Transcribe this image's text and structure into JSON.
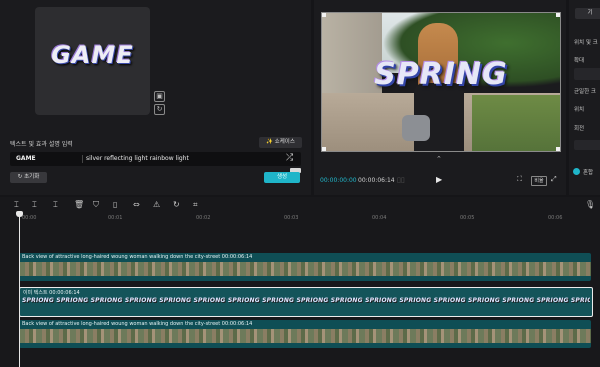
{
  "generator": {
    "preview_text": "GAME",
    "prompt_label": "텍스트 및 효과 설명 입력",
    "showcase_button": "✨ 쇼케이스",
    "text_value": "GAME",
    "effect_value": "silver reflecting light rainbow light",
    "reset_button": "↻ 초기화",
    "generate_button": "생성",
    "shuffle_icon": "shuffle-icon"
  },
  "preview": {
    "overlay_text": "SPRING",
    "time_current": "00:00:00:00",
    "time_total": "00:00:06:14",
    "ratio_label": "비율"
  },
  "right_panel": {
    "tab": "기",
    "labels": [
      "위치 및 크",
      "확대",
      "균일한 크",
      "위치",
      "회전"
    ],
    "checkbox_label": "혼합"
  },
  "timeline": {
    "ruler": [
      "00:00",
      "00:01",
      "00:02",
      "00:03",
      "00:04",
      "00:05",
      "00:06"
    ],
    "tracks": [
      {
        "title": "Back view of attractive long-haired woung woman walking down the city-street   00:00:06:14"
      },
      {
        "title": "이미 텍스트   00:00:06:14",
        "repeat_text": "SPRIONG SPRIONG SPRIONG SPRIONG SPRIONG SPRIONG SPRIONG SPRIONG SPRIONG SPRIONG SPRIONG SPRIONG SPRIONG SPRIONG SPRIONG SPRIONG SPRIONG SPRIONG SPRIONG SPRIONG"
      },
      {
        "title": "Back view of attractive long-haired woung woman walking down the city-street   00:00:06:14"
      }
    ]
  }
}
